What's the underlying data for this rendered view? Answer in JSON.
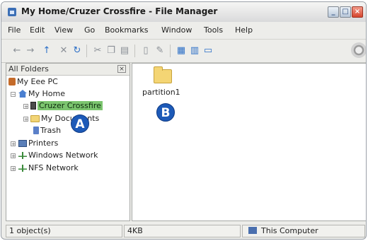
{
  "window": {
    "title": "My Home/Cruzer Crossfire - File Manager",
    "controls": {
      "minimize": "_",
      "maximize": "□",
      "close": "×"
    }
  },
  "menu": {
    "items": [
      "File",
      "Edit",
      "View",
      "Go",
      "Bookmarks",
      "Window",
      "Tools",
      "Help"
    ]
  },
  "toolbar": {
    "buttons": [
      {
        "icon": "back-arrow-icon",
        "glyph": "←"
      },
      {
        "icon": "forward-arrow-icon",
        "glyph": "→"
      },
      {
        "icon": "up-arrow-icon",
        "glyph": "↑"
      },
      {
        "icon": "stop-icon",
        "glyph": "✕"
      },
      {
        "icon": "reload-icon",
        "glyph": "↻"
      },
      {
        "icon": "cut-icon",
        "glyph": "✂"
      },
      {
        "icon": "copy-icon",
        "glyph": "❐"
      },
      {
        "icon": "paste-icon",
        "glyph": "▤"
      },
      {
        "icon": "new-file-icon",
        "glyph": "▯"
      },
      {
        "icon": "properties-icon",
        "glyph": "✎"
      },
      {
        "icon": "icon-view-icon",
        "glyph": "▦"
      },
      {
        "icon": "list-view-icon",
        "glyph": "▥"
      },
      {
        "icon": "compact-view-icon",
        "glyph": "▭"
      }
    ]
  },
  "sidebar": {
    "header": "All Folders",
    "close_glyph": "×",
    "tree": [
      {
        "label": "My Eee PC",
        "icon": "pc-icon",
        "expander": ""
      },
      {
        "label": "My Home",
        "icon": "home-icon",
        "expander": "−"
      },
      {
        "label": "Cruzer Crossfire",
        "icon": "usb-drive-icon",
        "expander": "+"
      },
      {
        "label": "My Documents",
        "icon": "folder-icon",
        "expander": "+"
      },
      {
        "label": "Trash",
        "icon": "trash-icon",
        "expander": ""
      },
      {
        "label": "Printers",
        "icon": "printer-icon",
        "expander": "+"
      },
      {
        "label": "Windows Network",
        "icon": "network-icon",
        "expander": "+"
      },
      {
        "label": "NFS Network",
        "icon": "network-icon",
        "expander": "+"
      }
    ]
  },
  "main": {
    "items": [
      {
        "label": "partition1",
        "icon": "folder-icon"
      }
    ]
  },
  "callouts": {
    "a": "A",
    "b": "B"
  },
  "statusbar": {
    "count": "1 object(s)",
    "size": "4KB",
    "location": "This Computer"
  },
  "colors": {
    "selection": "#7cc56f",
    "callout": "#1d5ab8",
    "folder": "#f4d574"
  }
}
